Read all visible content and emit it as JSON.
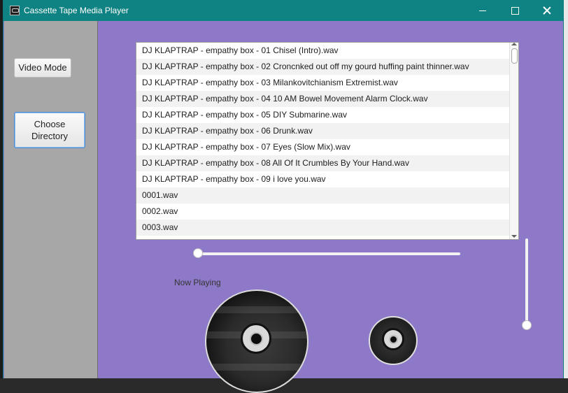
{
  "window": {
    "title": "Cassette Tape Media Player"
  },
  "sidebar": {
    "video_mode_label": "Video Mode",
    "choose_directory_label": "Choose Directory"
  },
  "playlist": {
    "items": [
      "DJ KLAPTRAP - empathy box - 01 Chisel (Intro).wav",
      "DJ KLAPTRAP - empathy box - 02 Croncnked out off my gourd huffing paint thinner.wav",
      "DJ KLAPTRAP - empathy box - 03 Milankovitchianism Extremist.wav",
      "DJ KLAPTRAP - empathy box - 04 10 AM Bowel Movement Alarm Clock.wav",
      "DJ KLAPTRAP - empathy box - 05 DIY Submarine.wav",
      "DJ KLAPTRAP - empathy box - 06 Drunk.wav",
      "DJ KLAPTRAP - empathy box - 07 Eyes (Slow Mix).wav",
      "DJ KLAPTRAP - empathy box - 08 All Of It Crumbles By Your Hand.wav",
      "DJ KLAPTRAP - empathy box - 09 i love you.wav",
      "0001.wav",
      "0002.wav",
      "0003.wav"
    ]
  },
  "player": {
    "now_playing_label": "Now Playing",
    "progress_fraction": 0.0,
    "volume_fraction": 0.0
  },
  "colors": {
    "titlebar": "#0f8283",
    "content_bg": "#8e79c8",
    "sidebar_bg": "#a7a7a7"
  },
  "icons": {
    "app": "cassette-icon",
    "minimize": "minimize-icon",
    "maximize": "maximize-icon",
    "close": "close-icon"
  }
}
